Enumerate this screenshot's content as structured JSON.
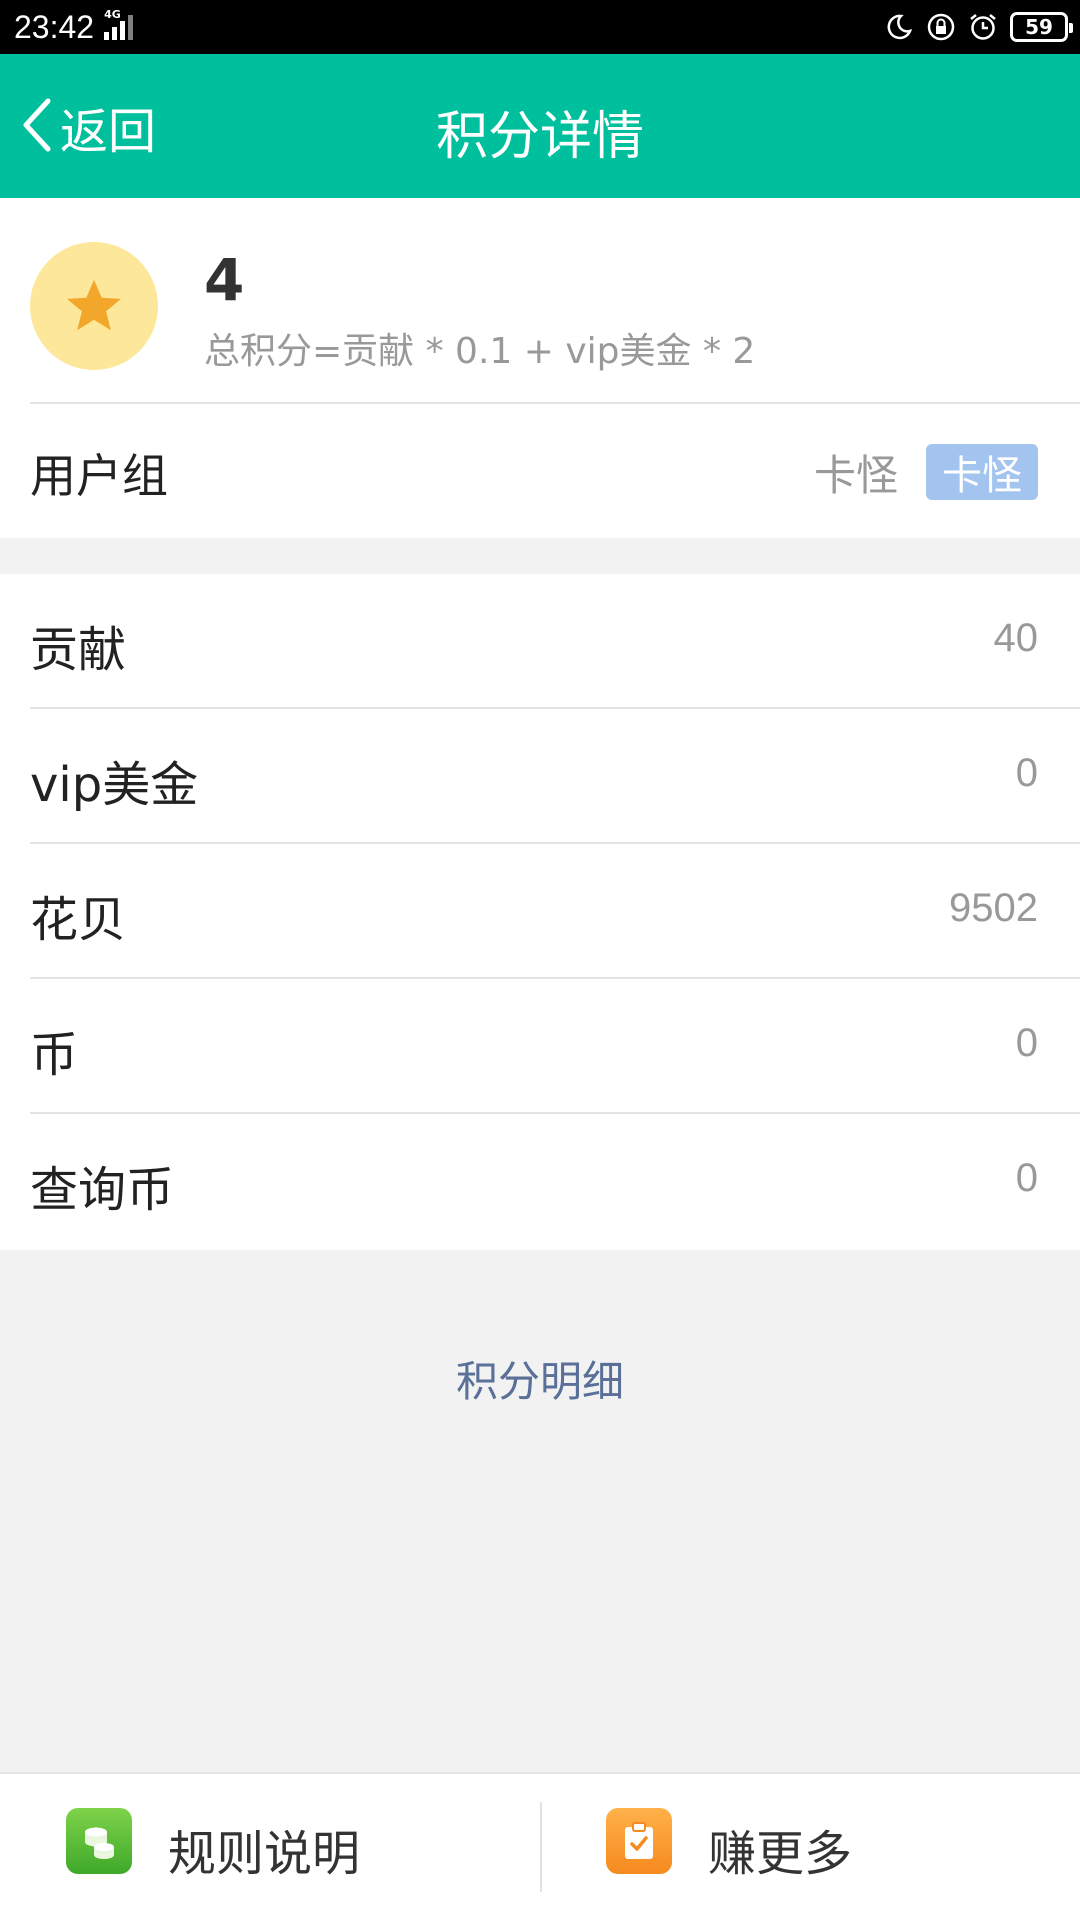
{
  "status_bar": {
    "time": "23:42",
    "network": "4G",
    "battery": "59",
    "icons": [
      "moon-icon",
      "lock-rotation-icon",
      "alarm-icon",
      "battery-icon"
    ]
  },
  "nav": {
    "back_label": "返回",
    "title": "积分详情"
  },
  "score": {
    "icon": "star-icon",
    "value": "4",
    "formula": "总积分=贡献 * 0.1 + vip美金 * 2"
  },
  "user_group": {
    "label": "用户组",
    "value": "卡怪",
    "badge": "卡怪"
  },
  "stats": [
    {
      "label": "贡献",
      "value": "40"
    },
    {
      "label": "vip美金",
      "value": "0"
    },
    {
      "label": "花贝",
      "value": "9502"
    },
    {
      "label": "币",
      "value": "0"
    },
    {
      "label": "查询币",
      "value": "0"
    }
  ],
  "detail_link": "积分明细",
  "bottom_bar": {
    "rules": {
      "label": "规则说明",
      "icon": "coins-icon"
    },
    "earn": {
      "label": "赚更多",
      "icon": "clipboard-check-icon"
    }
  },
  "colors": {
    "accent": "#00bf9c",
    "badge": "#a3c4ef",
    "link": "#5a7099",
    "star_bg": "#fde79a",
    "star": "#f2a62a"
  }
}
